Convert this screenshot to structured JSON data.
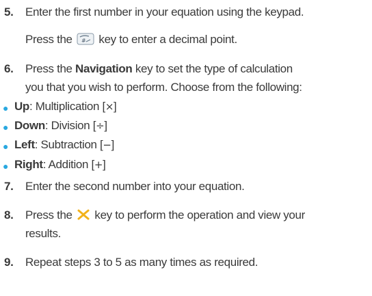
{
  "steps": {
    "s5": {
      "num": "5.",
      "text": "Enter the first number in your equation using the keypad.",
      "sub_a": "Press the",
      "sub_b": "key to enter a decimal point."
    },
    "s6": {
      "num": "6.",
      "pre": "Press the",
      "bold": "Navigation",
      "post": "key to set the type of calculation",
      "line2": "you that you wish to perform. Choose from the following:"
    },
    "s7": {
      "num": "7.",
      "text": "Enter the second number into your equation."
    },
    "s8": {
      "num": "8.",
      "pre": "Press the",
      "post": "key to perform the operation and view your",
      "line2": "results."
    },
    "s9": {
      "num": "9.",
      "text": "Repeat steps 3 to 5 as many times as required."
    }
  },
  "options": [
    {
      "key": "Up",
      "desc": ": Multiplication [",
      "sym": "×",
      "close": "]"
    },
    {
      "key": "Down",
      "desc": ": Division [",
      "sym": "÷",
      "close": "]"
    },
    {
      "key": "Left",
      "desc": ": Subtraction [",
      "sym": "−",
      "close": "]"
    },
    {
      "key": "Right",
      "desc": ": Addition [",
      "sym": "+",
      "close": "]"
    }
  ],
  "colors": {
    "bullet": "#29a8e0",
    "text": "#3a3a3a",
    "cross_key": "#f2b21b"
  },
  "icons": {
    "hash_key": "hash-key-icon",
    "cross_key": "cross-key-icon"
  }
}
